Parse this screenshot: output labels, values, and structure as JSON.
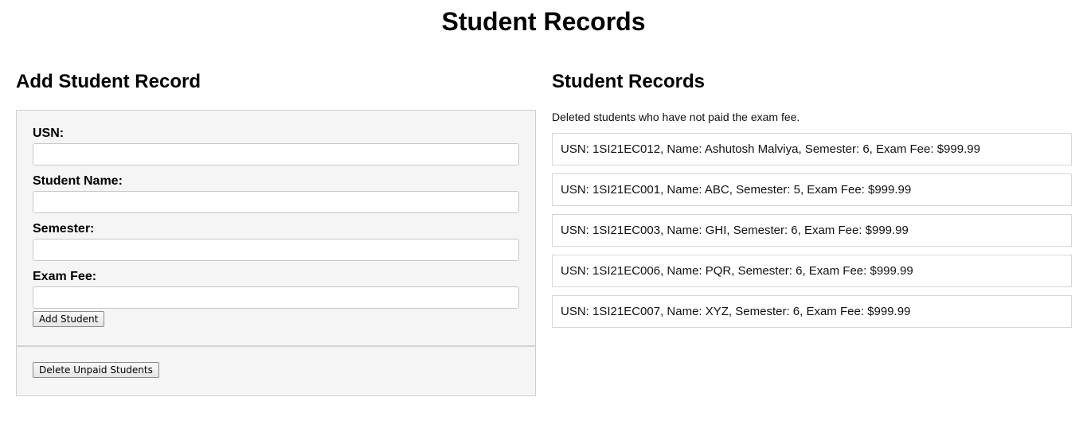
{
  "page": {
    "title": "Student Records"
  },
  "form_section": {
    "title": "Add Student Record",
    "fields": [
      {
        "label": "USN:",
        "value": ""
      },
      {
        "label": "Student Name:",
        "value": ""
      },
      {
        "label": "Semester:",
        "value": ""
      },
      {
        "label": "Exam Fee:",
        "value": ""
      }
    ],
    "add_button_label": "Add Student",
    "delete_button_label": "Delete Unpaid Students"
  },
  "records_section": {
    "title": "Student Records",
    "status_message": "Deleted students who have not paid the exam fee.",
    "records": [
      "USN: 1SI21EC012, Name: Ashutosh Malviya, Semester: 6, Exam Fee: $999.99",
      "USN: 1SI21EC001, Name: ABC, Semester: 5, Exam Fee: $999.99",
      "USN: 1SI21EC003, Name: GHI, Semester: 6, Exam Fee: $999.99",
      "USN: 1SI21EC006, Name: PQR, Semester: 6, Exam Fee: $999.99",
      "USN: 1SI21EC007, Name: XYZ, Semester: 6, Exam Fee: $999.99"
    ]
  },
  "colors": {
    "panel_background": "#f5f5f5",
    "panel_border": "#cfcfcf",
    "record_border": "#d6d6d6"
  }
}
